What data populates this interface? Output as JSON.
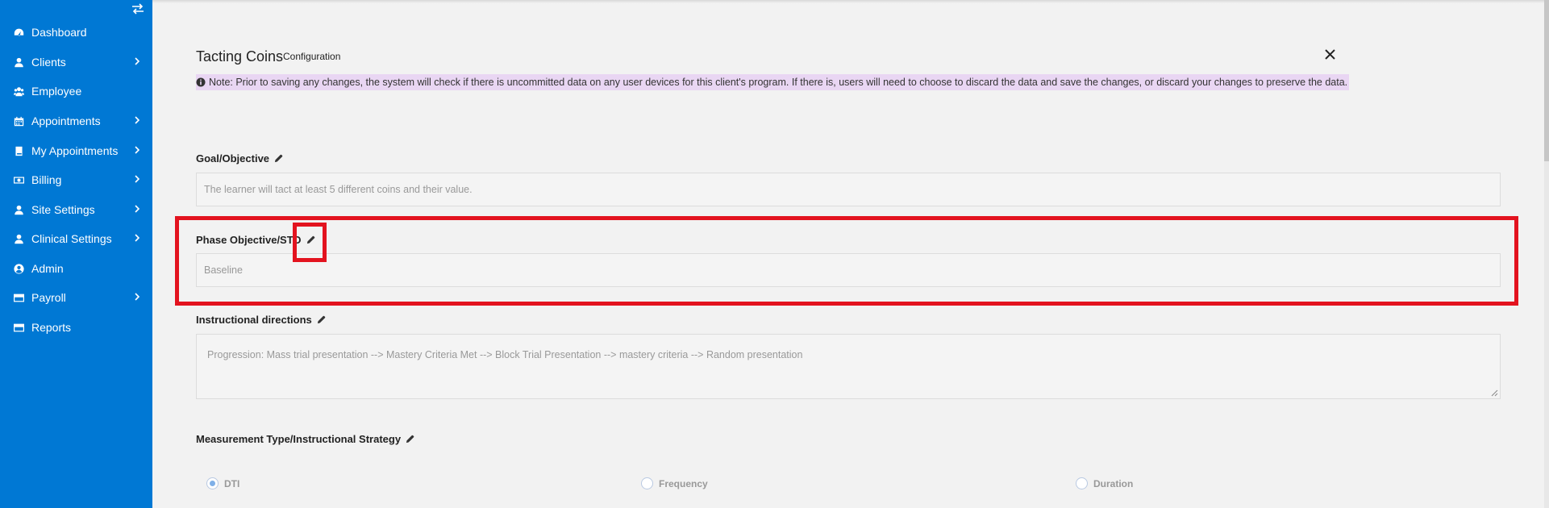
{
  "sidebar": {
    "items": [
      {
        "label": "Dashboard",
        "icon": "dashboard-icon",
        "chevron": false
      },
      {
        "label": "Clients",
        "icon": "user-icon",
        "chevron": true
      },
      {
        "label": "Employee",
        "icon": "users-icon",
        "chevron": false
      },
      {
        "label": "Appointments",
        "icon": "calendar-icon",
        "chevron": true
      },
      {
        "label": "My Appointments",
        "icon": "book-icon",
        "chevron": true
      },
      {
        "label": "Billing",
        "icon": "money-icon",
        "chevron": true
      },
      {
        "label": "Site Settings",
        "icon": "user-icon",
        "chevron": true
      },
      {
        "label": "Clinical Settings",
        "icon": "user-icon",
        "chevron": true
      },
      {
        "label": "Admin",
        "icon": "user-circle-icon",
        "chevron": false
      },
      {
        "label": "Payroll",
        "icon": "credit-card-icon",
        "chevron": true
      },
      {
        "label": "Reports",
        "icon": "credit-card-icon",
        "chevron": false
      }
    ]
  },
  "header": {
    "title": "Tacting Coins",
    "subtitle": "Configuration"
  },
  "note": "Note: Prior to saving any changes, the system will check if there is uncommitted data on any user devices for this client's program. If there is, users will need to choose to discard the data and save the changes, or discard your changes to preserve the data.",
  "form": {
    "goal_label": "Goal/Objective",
    "goal_value": "The learner will tact at least 5 different coins and their value.",
    "phase_label": "Phase Objective/STO",
    "phase_value": "Baseline",
    "directions_label": "Instructional directions",
    "directions_value": "Progression: Mass trial presentation --> Mastery Criteria Met --> Block Trial Presentation --> mastery criteria --> Random presentation",
    "measurement_label": "Measurement Type/Instructional Strategy",
    "options": [
      {
        "label": "DTI",
        "selected": true
      },
      {
        "label": "Frequency",
        "selected": false
      },
      {
        "label": "Duration",
        "selected": false
      }
    ]
  },
  "colors": {
    "sidebar_bg": "#0078d4",
    "highlight": "#e3131f",
    "note_bg": "#e9d6f3"
  }
}
